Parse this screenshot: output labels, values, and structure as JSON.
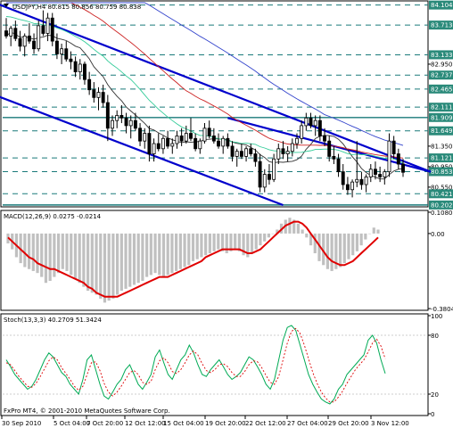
{
  "chart_data": {
    "type": "candlestick",
    "window": {
      "symbol_header": "USDJPY,H4 80.815 80.856 80.759 80.838",
      "copyright": "FxPro MT4, © 2001-2010 MetaQuotes Software Corp."
    },
    "price_panel": {
      "ylim": [
        80.2,
        84.15
      ],
      "ticks": [
        "84.104",
        "83.713",
        "83.133",
        "82.950",
        "82.737",
        "82.465",
        "82.111",
        "81.909",
        "81.649",
        "81.350",
        "81.121",
        "80.950",
        "80.853",
        "80.550",
        "80.421",
        "80.202"
      ],
      "tick_values": [
        84.104,
        83.713,
        83.133,
        82.95,
        82.737,
        82.465,
        82.111,
        81.909,
        81.649,
        81.35,
        81.121,
        80.95,
        80.853,
        80.55,
        80.421,
        80.202
      ],
      "highlighted_ticks": [
        "84.104",
        "83.713",
        "83.133",
        "82.737",
        "82.465",
        "82.111",
        "81.909",
        "81.649",
        "81.121",
        "80.853",
        "80.421",
        "80.202"
      ],
      "current_price": "80.853",
      "candles": [
        {
          "o": 83.6,
          "h": 83.85,
          "l": 83.45,
          "c": 83.5
        },
        {
          "o": 83.5,
          "h": 83.7,
          "l": 83.3,
          "c": 83.65
        },
        {
          "o": 83.65,
          "h": 83.8,
          "l": 83.4,
          "c": 83.45
        },
        {
          "o": 83.45,
          "h": 83.6,
          "l": 83.2,
          "c": 83.3
        },
        {
          "o": 83.3,
          "h": 83.55,
          "l": 83.1,
          "c": 83.5
        },
        {
          "o": 83.5,
          "h": 83.75,
          "l": 83.35,
          "c": 83.4
        },
        {
          "o": 83.4,
          "h": 83.55,
          "l": 83.15,
          "c": 83.25
        },
        {
          "o": 83.25,
          "h": 83.8,
          "l": 83.2,
          "c": 83.7
        },
        {
          "o": 83.7,
          "h": 84.0,
          "l": 83.5,
          "c": 83.55
        },
        {
          "o": 83.55,
          "h": 83.95,
          "l": 83.4,
          "c": 83.85
        },
        {
          "o": 83.85,
          "h": 83.95,
          "l": 83.3,
          "c": 83.4
        },
        {
          "o": 83.4,
          "h": 83.55,
          "l": 83.05,
          "c": 83.15
        },
        {
          "o": 83.15,
          "h": 83.35,
          "l": 82.95,
          "c": 83.25
        },
        {
          "o": 83.25,
          "h": 83.4,
          "l": 83.0,
          "c": 83.05
        },
        {
          "o": 83.05,
          "h": 83.2,
          "l": 82.85,
          "c": 83.0
        },
        {
          "o": 83.0,
          "h": 83.1,
          "l": 82.7,
          "c": 82.8
        },
        {
          "o": 82.8,
          "h": 83.05,
          "l": 82.65,
          "c": 82.95
        },
        {
          "o": 82.95,
          "h": 83.0,
          "l": 82.55,
          "c": 82.65
        },
        {
          "o": 82.65,
          "h": 82.8,
          "l": 82.35,
          "c": 82.45
        },
        {
          "o": 82.45,
          "h": 82.6,
          "l": 82.2,
          "c": 82.3
        },
        {
          "o": 82.3,
          "h": 82.5,
          "l": 82.05,
          "c": 82.4
        },
        {
          "o": 82.4,
          "h": 82.55,
          "l": 82.1,
          "c": 82.2
        },
        {
          "o": 82.2,
          "h": 82.35,
          "l": 81.45,
          "c": 81.7
        },
        {
          "o": 81.7,
          "h": 81.95,
          "l": 81.55,
          "c": 81.85
        },
        {
          "o": 81.85,
          "h": 82.05,
          "l": 81.7,
          "c": 81.95
        },
        {
          "o": 81.95,
          "h": 82.15,
          "l": 81.8,
          "c": 81.9
        },
        {
          "o": 81.9,
          "h": 82.0,
          "l": 81.6,
          "c": 81.75
        },
        {
          "o": 81.75,
          "h": 81.95,
          "l": 81.5,
          "c": 81.85
        },
        {
          "o": 81.85,
          "h": 82.0,
          "l": 81.65,
          "c": 81.7
        },
        {
          "o": 81.7,
          "h": 81.8,
          "l": 81.35,
          "c": 81.45
        },
        {
          "o": 81.45,
          "h": 81.7,
          "l": 81.3,
          "c": 81.6
        },
        {
          "o": 81.6,
          "h": 81.75,
          "l": 81.05,
          "c": 81.2
        },
        {
          "o": 81.2,
          "h": 81.5,
          "l": 81.05,
          "c": 81.4
        },
        {
          "o": 81.4,
          "h": 81.6,
          "l": 81.25,
          "c": 81.3
        },
        {
          "o": 81.3,
          "h": 81.55,
          "l": 81.2,
          "c": 81.5
        },
        {
          "o": 81.5,
          "h": 81.65,
          "l": 81.3,
          "c": 81.35
        },
        {
          "o": 81.35,
          "h": 81.5,
          "l": 81.2,
          "c": 81.4
        },
        {
          "o": 81.4,
          "h": 81.65,
          "l": 81.3,
          "c": 81.55
        },
        {
          "o": 81.55,
          "h": 81.7,
          "l": 81.35,
          "c": 81.45
        },
        {
          "o": 81.45,
          "h": 81.75,
          "l": 81.4,
          "c": 81.6
        },
        {
          "o": 81.6,
          "h": 81.9,
          "l": 81.45,
          "c": 81.5
        },
        {
          "o": 81.5,
          "h": 81.6,
          "l": 81.25,
          "c": 81.3
        },
        {
          "o": 81.3,
          "h": 81.5,
          "l": 81.2,
          "c": 81.45
        },
        {
          "o": 81.45,
          "h": 81.8,
          "l": 81.4,
          "c": 81.7
        },
        {
          "o": 81.7,
          "h": 81.85,
          "l": 81.5,
          "c": 81.55
        },
        {
          "o": 81.55,
          "h": 81.7,
          "l": 81.4,
          "c": 81.45
        },
        {
          "o": 81.45,
          "h": 81.6,
          "l": 81.3,
          "c": 81.35
        },
        {
          "o": 81.35,
          "h": 81.55,
          "l": 81.2,
          "c": 81.5
        },
        {
          "o": 81.5,
          "h": 81.6,
          "l": 81.3,
          "c": 81.35
        },
        {
          "o": 81.35,
          "h": 81.45,
          "l": 81.05,
          "c": 81.15
        },
        {
          "o": 81.15,
          "h": 81.3,
          "l": 80.95,
          "c": 81.25
        },
        {
          "o": 81.25,
          "h": 81.4,
          "l": 81.1,
          "c": 81.15
        },
        {
          "o": 81.15,
          "h": 81.35,
          "l": 81.05,
          "c": 81.3
        },
        {
          "o": 81.3,
          "h": 81.4,
          "l": 81.15,
          "c": 81.2
        },
        {
          "o": 81.2,
          "h": 81.3,
          "l": 80.95,
          "c": 81.05
        },
        {
          "o": 81.05,
          "h": 81.2,
          "l": 80.45,
          "c": 80.55
        },
        {
          "o": 80.55,
          "h": 80.9,
          "l": 80.45,
          "c": 80.8
        },
        {
          "o": 80.8,
          "h": 81.0,
          "l": 80.6,
          "c": 80.7
        },
        {
          "o": 80.7,
          "h": 81.2,
          "l": 80.65,
          "c": 81.1
        },
        {
          "o": 81.1,
          "h": 81.4,
          "l": 81.0,
          "c": 81.3
        },
        {
          "o": 81.3,
          "h": 81.45,
          "l": 81.1,
          "c": 81.2
        },
        {
          "o": 81.2,
          "h": 81.35,
          "l": 81.05,
          "c": 81.25
        },
        {
          "o": 81.25,
          "h": 81.5,
          "l": 81.15,
          "c": 81.4
        },
        {
          "o": 81.4,
          "h": 81.6,
          "l": 81.3,
          "c": 81.5
        },
        {
          "o": 81.5,
          "h": 81.85,
          "l": 81.4,
          "c": 81.75
        },
        {
          "o": 81.75,
          "h": 82.0,
          "l": 81.65,
          "c": 81.9
        },
        {
          "o": 81.9,
          "h": 82.0,
          "l": 81.7,
          "c": 81.75
        },
        {
          "o": 81.75,
          "h": 81.95,
          "l": 81.55,
          "c": 81.85
        },
        {
          "o": 81.85,
          "h": 81.95,
          "l": 81.45,
          "c": 81.55
        },
        {
          "o": 81.55,
          "h": 81.7,
          "l": 81.35,
          "c": 81.45
        },
        {
          "o": 81.45,
          "h": 81.55,
          "l": 81.05,
          "c": 81.15
        },
        {
          "o": 81.15,
          "h": 81.35,
          "l": 81.0,
          "c": 81.1
        },
        {
          "o": 81.1,
          "h": 81.2,
          "l": 80.75,
          "c": 80.85
        },
        {
          "o": 80.85,
          "h": 81.0,
          "l": 80.5,
          "c": 80.6
        },
        {
          "o": 80.6,
          "h": 80.75,
          "l": 80.4,
          "c": 80.5
        },
        {
          "o": 80.5,
          "h": 80.7,
          "l": 80.35,
          "c": 80.65
        },
        {
          "o": 80.65,
          "h": 81.45,
          "l": 80.55,
          "c": 80.7
        },
        {
          "o": 80.7,
          "h": 80.85,
          "l": 80.5,
          "c": 80.6
        },
        {
          "o": 80.6,
          "h": 80.8,
          "l": 80.45,
          "c": 80.75
        },
        {
          "o": 80.75,
          "h": 81.0,
          "l": 80.65,
          "c": 80.9
        },
        {
          "o": 80.9,
          "h": 81.05,
          "l": 80.7,
          "c": 80.8
        },
        {
          "o": 80.8,
          "h": 80.95,
          "l": 80.65,
          "c": 80.75
        },
        {
          "o": 80.75,
          "h": 80.9,
          "l": 80.6,
          "c": 80.85
        },
        {
          "o": 80.85,
          "h": 81.6,
          "l": 80.75,
          "c": 81.45
        },
        {
          "o": 81.45,
          "h": 81.55,
          "l": 81.1,
          "c": 81.2
        },
        {
          "o": 81.2,
          "h": 81.3,
          "l": 80.9,
          "c": 81.0
        },
        {
          "o": 81.0,
          "h": 81.1,
          "l": 80.75,
          "c": 80.84
        }
      ],
      "lines": {
        "upper_channel": {
          "color": "#0000cc",
          "from": {
            "bar": -4,
            "price": 84.2
          },
          "to": {
            "bar": 92,
            "price": 80.85
          }
        },
        "lower_channel": {
          "color": "#0000cc",
          "from": {
            "bar": -4,
            "price": 82.4
          },
          "to": {
            "bar": 60,
            "price": 80.2
          }
        },
        "mid_channel": {
          "color": "#0000cc",
          "from": {
            "bar": 48,
            "price": 81.9
          },
          "to": {
            "bar": 92,
            "price": 80.85
          }
        }
      }
    },
    "macd_panel": {
      "label": "MACD(12,26,9) 0.0275 -0.0214",
      "ticks": [
        "0.1080",
        "0.00",
        "-0.3804"
      ],
      "tick_values": [
        0.108,
        0.0,
        -0.3804
      ],
      "ylim": [
        -0.38,
        0.108
      ],
      "histogram": [
        -0.05,
        -0.08,
        -0.12,
        -0.15,
        -0.17,
        -0.18,
        -0.19,
        -0.2,
        -0.22,
        -0.25,
        -0.24,
        -0.22,
        -0.2,
        -0.18,
        -0.19,
        -0.21,
        -0.23,
        -0.25,
        -0.27,
        -0.29,
        -0.3,
        -0.31,
        -0.33,
        -0.35,
        -0.34,
        -0.33,
        -0.31,
        -0.29,
        -0.28,
        -0.27,
        -0.26,
        -0.25,
        -0.24,
        -0.22,
        -0.21,
        -0.2,
        -0.21,
        -0.22,
        -0.21,
        -0.2,
        -0.19,
        -0.18,
        -0.17,
        -0.16,
        -0.14,
        -0.13,
        -0.12,
        -0.11,
        -0.1,
        -0.09,
        -0.08,
        -0.09,
        -0.1,
        -0.09,
        -0.08,
        -0.09,
        -0.11,
        -0.12,
        -0.1,
        -0.08,
        -0.06,
        -0.04,
        -0.02,
        0.0,
        0.02,
        0.05,
        0.07,
        0.08,
        0.07,
        0.05,
        0.02,
        -0.02,
        -0.06,
        -0.1,
        -0.14,
        -0.16,
        -0.18,
        -0.19,
        -0.18,
        -0.17,
        -0.15,
        -0.13,
        -0.11,
        -0.09,
        -0.06,
        -0.03,
        0.0,
        0.03,
        0.02
      ],
      "signal": [
        -0.02,
        -0.04,
        -0.06,
        -0.08,
        -0.1,
        -0.12,
        -0.13,
        -0.15,
        -0.16,
        -0.17,
        -0.18,
        -0.18,
        -0.19,
        -0.2,
        -0.21,
        -0.22,
        -0.23,
        -0.24,
        -0.25,
        -0.27,
        -0.28,
        -0.3,
        -0.31,
        -0.32,
        -0.32,
        -0.32,
        -0.32,
        -0.31,
        -0.3,
        -0.29,
        -0.28,
        -0.27,
        -0.26,
        -0.25,
        -0.24,
        -0.23,
        -0.22,
        -0.22,
        -0.22,
        -0.21,
        -0.2,
        -0.19,
        -0.18,
        -0.17,
        -0.16,
        -0.15,
        -0.14,
        -0.12,
        -0.11,
        -0.1,
        -0.09,
        -0.08,
        -0.08,
        -0.08,
        -0.08,
        -0.08,
        -0.09,
        -0.1,
        -0.1,
        -0.09,
        -0.08,
        -0.06,
        -0.04,
        -0.02,
        0.0,
        0.02,
        0.04,
        0.05,
        0.06,
        0.06,
        0.05,
        0.03,
        0.0,
        -0.03,
        -0.06,
        -0.09,
        -0.12,
        -0.14,
        -0.15,
        -0.16,
        -0.16,
        -0.15,
        -0.14,
        -0.12,
        -0.1,
        -0.08,
        -0.06,
        -0.04,
        -0.02
      ]
    },
    "stoch_panel": {
      "label": "Stoch(13,3,3) 40.2709 51.3424",
      "ticks": [
        "100",
        "80",
        "20",
        "0"
      ],
      "tick_values": [
        100,
        80,
        20,
        0
      ],
      "ylim": [
        0,
        100
      ],
      "k": [
        55,
        48,
        40,
        35,
        30,
        25,
        28,
        35,
        45,
        55,
        62,
        58,
        50,
        42,
        38,
        30,
        25,
        20,
        35,
        55,
        60,
        45,
        30,
        18,
        15,
        22,
        30,
        35,
        45,
        50,
        40,
        30,
        25,
        32,
        40,
        58,
        65,
        52,
        40,
        35,
        45,
        55,
        60,
        70,
        62,
        50,
        40,
        38,
        45,
        50,
        55,
        48,
        40,
        35,
        38,
        42,
        50,
        58,
        55,
        48,
        40,
        30,
        25,
        35,
        55,
        75,
        88,
        90,
        85,
        70,
        55,
        40,
        30,
        22,
        15,
        12,
        10,
        15,
        25,
        30,
        40,
        45,
        50,
        55,
        60,
        75,
        80,
        72,
        55,
        41
      ],
      "d": [
        52,
        50,
        44,
        38,
        33,
        28,
        27,
        31,
        38,
        46,
        54,
        58,
        55,
        47,
        41,
        35,
        28,
        24,
        28,
        40,
        52,
        53,
        44,
        31,
        22,
        18,
        22,
        28,
        35,
        42,
        44,
        40,
        32,
        30,
        33,
        45,
        54,
        57,
        52,
        43,
        41,
        45,
        52,
        60,
        64,
        60,
        51,
        44,
        42,
        45,
        50,
        51,
        48,
        42,
        38,
        38,
        43,
        50,
        54,
        53,
        47,
        39,
        32,
        30,
        38,
        55,
        72,
        84,
        87,
        82,
        70,
        56,
        42,
        31,
        22,
        16,
        12,
        12,
        17,
        23,
        31,
        38,
        45,
        50,
        55,
        63,
        72,
        76,
        69,
        56
      ]
    },
    "x_axis": {
      "tick_labels": [
        "30 Sep 2010",
        "5 Oct 04:00",
        "7 Oct 20:00",
        "12 Oct 12:00",
        "15 Oct 04:00",
        "19 Oct 20:00",
        "22 Oct 12:00",
        "27 Oct 04:00",
        "29 Oct 20:00",
        "3 Nov 12:00"
      ],
      "tick_bars": [
        0,
        11,
        23,
        35,
        46,
        58,
        69,
        81,
        92,
        103
      ]
    },
    "colors": {
      "candle": "#000000",
      "channel": "#0000cc",
      "ma_red": "#cc2222",
      "ma_green": "#33cc99",
      "ma_black": "#333333",
      "ma_blue": "#3344cc",
      "macd_hist": "#c0c0c0",
      "macd_signal": "#e00000",
      "stoch_main": "#00aa55",
      "stoch_signal": "#dd0000",
      "grid_dash": "#1a7a7a",
      "tick_highlight": "#2a8a7a"
    }
  }
}
